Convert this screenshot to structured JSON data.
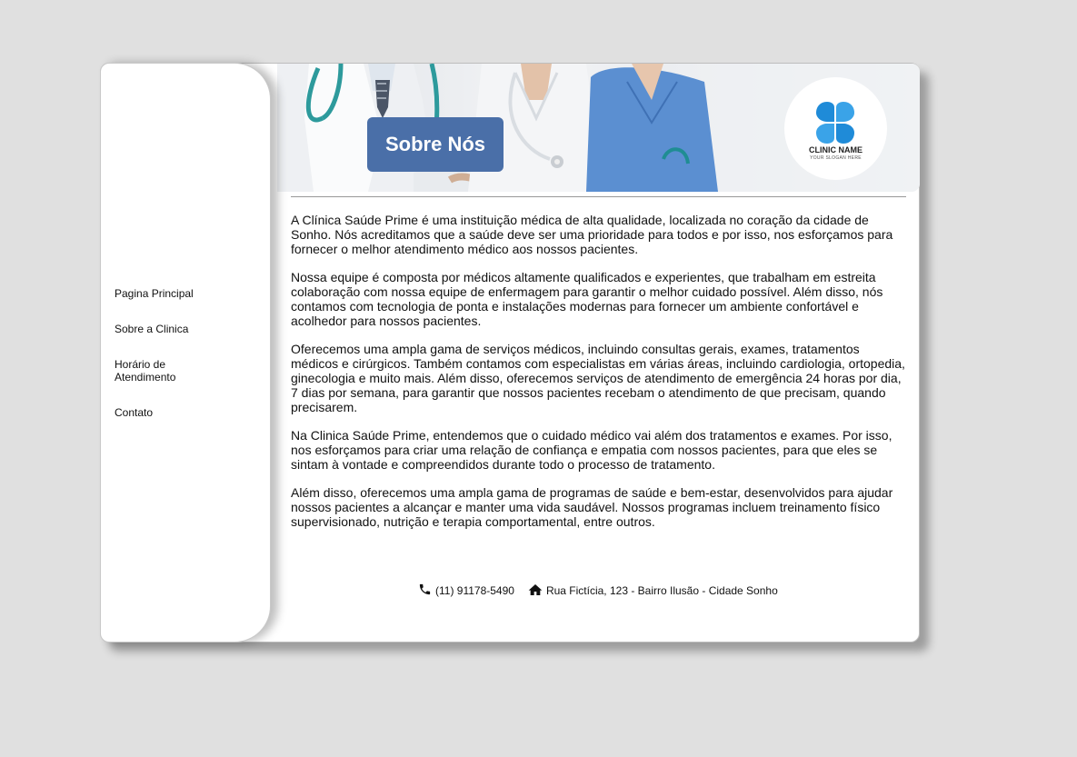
{
  "nav": {
    "items": [
      {
        "label": "Pagina Principal"
      },
      {
        "label": "Sobre a Clinica"
      },
      {
        "label": "Horário de Atendimento"
      },
      {
        "label": "Contato"
      }
    ]
  },
  "header": {
    "title": "Sobre Nós",
    "title_bg": "#4a6fa8",
    "logo": {
      "name": "CLINIC NAME",
      "slogan": "YOUR SLOGAN HERE",
      "icon": "four-leaf-clinic-icon"
    }
  },
  "content": {
    "paragraphs": [
      "A Clínica Saúde Prime é uma instituição médica de alta qualidade, localizada no coração da cidade de Sonho. Nós acreditamos que a saúde deve ser uma prioridade para todos e por isso, nos esforçamos para fornecer o melhor atendimento médico aos nossos pacientes.",
      "Nossa equipe é composta por médicos altamente qualificados e experientes, que trabalham em estreita colaboração com nossa equipe de enfermagem para garantir o melhor cuidado possível. Além disso, nós contamos com tecnologia de ponta e instalações modernas para fornecer um ambiente confortável e acolhedor para nossos pacientes.",
      "Oferecemos uma ampla gama de serviços médicos, incluindo consultas gerais, exames, tratamentos médicos e cirúrgicos. Também contamos com especialistas em várias áreas, incluindo cardiologia, ortopedia, ginecologia e muito mais. Além disso, oferecemos serviços de atendimento de emergência 24 horas por dia, 7 dias por semana, para garantir que nossos pacientes recebam o atendimento de que precisam, quando precisarem.",
      "Na Clinica Saúde Prime, entendemos que o cuidado médico vai além dos tratamentos e exames. Por isso, nos esforçamos para criar uma relação de confiança e empatia com nossos pacientes, para que eles se sintam à vontade e compreendidos durante todo o processo de tratamento.",
      "Além disso, oferecemos uma ampla gama de programas de saúde e bem-estar, desenvolvidos para ajudar nossos pacientes a alcançar e manter uma vida saudável. Nossos programas incluem treinamento físico supervisionado, nutrição e terapia comportamental, entre outros."
    ]
  },
  "footer": {
    "phone": "(11) 91178-5490",
    "phone_icon": "phone-icon",
    "address": "Rua Fictícia, 123 - Bairro Ilusão - Cidade Sonho",
    "address_icon": "home-icon"
  }
}
